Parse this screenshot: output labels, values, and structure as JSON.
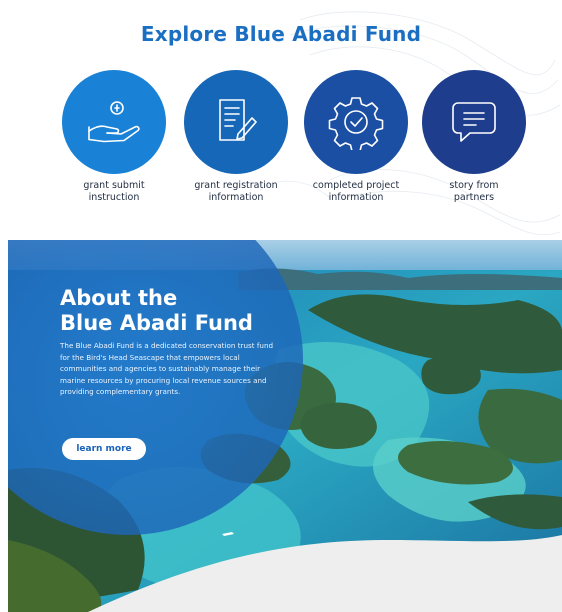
{
  "page_title": "Explore Blue Abadi Fund",
  "tiles": [
    {
      "label": "grant submit\ninstruction",
      "icon": "hand-coin-icon",
      "color": "#1a82d6"
    },
    {
      "label": "grant registration\ninformation",
      "icon": "document-pen-icon",
      "color": "#1767b8"
    },
    {
      "label": "completed project\ninformation",
      "icon": "gear-check-icon",
      "color": "#1a4fa3"
    },
    {
      "label": "story from\npartners",
      "icon": "speech-bubble-icon",
      "color": "#1e3d8d"
    }
  ],
  "about": {
    "title_line1": "About the",
    "title_line2": "Blue Abadi Fund",
    "description": "The Blue Abadi Fund is a dedicated conservation trust fund for the Bird's Head Seascape that empowers local communities and agencies to sustainably manage their marine resources by procuring local revenue sources and providing complementary grants.",
    "button_label": "learn more"
  },
  "colors": {
    "title_blue": "#1b6fc3",
    "overlay_blue": "#1f6fc4",
    "sea_turquoise": "#3fc1c9"
  }
}
